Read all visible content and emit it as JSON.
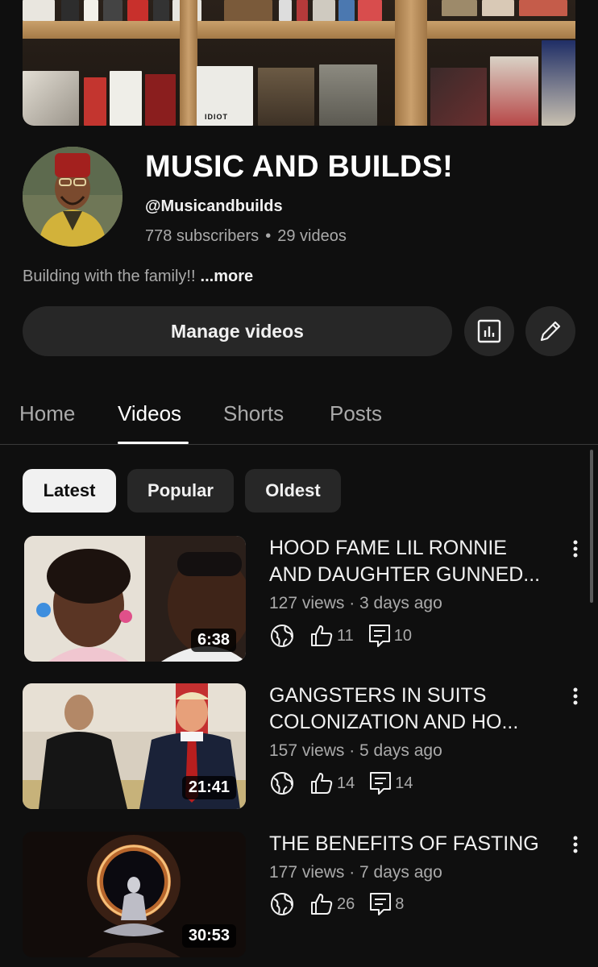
{
  "channel": {
    "name": "MUSIC AND BUILDS!",
    "handle": "@Musicandbuilds",
    "subscribers": "778 subscribers",
    "videos_count": "29 videos",
    "separator": "•",
    "description": "Building with the family!!",
    "more_label": "...more",
    "manage_label": "Manage videos"
  },
  "tabs": [
    {
      "label": "Home",
      "active": false
    },
    {
      "label": "Videos",
      "active": true
    },
    {
      "label": "Shorts",
      "active": false
    },
    {
      "label": "Posts",
      "active": false
    }
  ],
  "filters": [
    {
      "label": "Latest",
      "selected": true
    },
    {
      "label": "Popular",
      "selected": false
    },
    {
      "label": "Oldest",
      "selected": false
    }
  ],
  "videos": [
    {
      "title_line1": "HOOD FAME LIL RONNIE",
      "title_line2": "AND DAUGHTER GUNNED...",
      "meta": "127 views · 3 days ago",
      "duration": "6:38",
      "likes": "11",
      "comments": "10"
    },
    {
      "title_line1": "GANGSTERS IN SUITS",
      "title_line2": "COLONIZATION AND HO...",
      "meta": "157 views · 5 days ago",
      "duration": "21:41",
      "likes": "14",
      "comments": "14"
    },
    {
      "title_line1": "THE BENEFITS OF FASTING",
      "title_line2": "",
      "meta": "177 views · 7 days ago",
      "duration": "30:53",
      "likes": "26",
      "comments": "8"
    }
  ],
  "banner_art_text": "IDIOT",
  "icons": {
    "visibility": "globe-icon",
    "like": "thumbs-up-icon",
    "comment": "comment-icon",
    "analytics": "analytics-icon",
    "edit": "pencil-icon",
    "menu": "more-vert-icon"
  },
  "colors": {
    "background": "#0f0f0f",
    "surface": "#272727",
    "text_primary": "#f1f1f1",
    "text_secondary": "#aaaaaa"
  }
}
